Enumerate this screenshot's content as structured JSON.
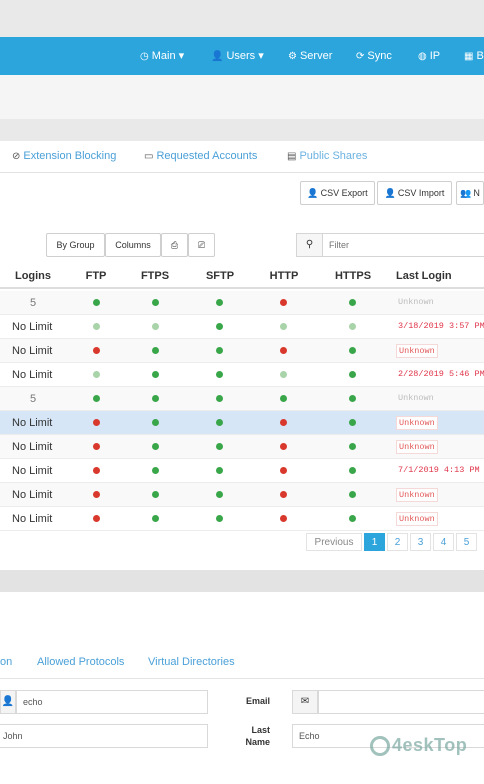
{
  "nav": {
    "items": [
      {
        "label": "Main",
        "icon": "clock-icon",
        "caret": "▾"
      },
      {
        "label": "Users",
        "icon": "user-icon",
        "caret": "▾"
      },
      {
        "label": "Server",
        "icon": "gear-icon",
        "caret": ""
      },
      {
        "label": "Sync",
        "icon": "sync-icon",
        "caret": ""
      },
      {
        "label": "IP",
        "icon": "globe-icon",
        "caret": ""
      },
      {
        "label": "B",
        "icon": "grid-icon",
        "caret": ""
      }
    ]
  },
  "tabs": [
    {
      "label": "Extension Blocking",
      "icon": "block-icon"
    },
    {
      "label": "Requested  Accounts",
      "icon": "inbox-icon"
    },
    {
      "label": "Public Shares",
      "icon": "share-icon"
    }
  ],
  "toolbar": {
    "csv_export": "CSV Export",
    "csv_import": "CSV Import",
    "new_label": "N",
    "by_group": "By Group",
    "columns": "Columns",
    "search_placeholder": "Filter"
  },
  "table": {
    "headers": [
      "Logins",
      "FTP",
      "FTPS",
      "SFTP",
      "HTTP",
      "HTTPS",
      "Last Login"
    ],
    "rows": [
      {
        "logins": "5",
        "faded": true,
        "ftp": "green",
        "ftps": "green",
        "sftp": "green",
        "http": "red",
        "https": "green",
        "last_login": "Unknown",
        "ll_style": "faded",
        "style": "alt"
      },
      {
        "logins": "No Limit",
        "faded": false,
        "ftp": "lightgreen",
        "ftps": "lightgreen",
        "sftp": "green",
        "http": "lightgreen",
        "https": "lightgreen",
        "last_login": "3/18/2019 3:57 PM",
        "ll_style": "date",
        "style": ""
      },
      {
        "logins": "No Limit",
        "faded": false,
        "ftp": "red",
        "ftps": "green",
        "sftp": "green",
        "http": "red",
        "https": "green",
        "last_login": "Unknown",
        "ll_style": "unknown",
        "style": "alt"
      },
      {
        "logins": "No Limit",
        "faded": false,
        "ftp": "lightgreen",
        "ftps": "green",
        "sftp": "green",
        "http": "lightgreen",
        "https": "green",
        "last_login": "2/28/2019 5:46 PM",
        "ll_style": "date",
        "style": ""
      },
      {
        "logins": "5",
        "faded": true,
        "ftp": "green",
        "ftps": "green",
        "sftp": "green",
        "http": "green",
        "https": "green",
        "last_login": "Unknown",
        "ll_style": "faded",
        "style": "alt"
      },
      {
        "logins": "No Limit",
        "faded": false,
        "ftp": "red",
        "ftps": "green",
        "sftp": "green",
        "http": "red",
        "https": "green",
        "last_login": "Unknown",
        "ll_style": "unknown",
        "style": "sel"
      },
      {
        "logins": "No Limit",
        "faded": false,
        "ftp": "red",
        "ftps": "green",
        "sftp": "green",
        "http": "red",
        "https": "green",
        "last_login": "Unknown",
        "ll_style": "unknown",
        "style": "alt"
      },
      {
        "logins": "No Limit",
        "faded": false,
        "ftp": "red",
        "ftps": "green",
        "sftp": "green",
        "http": "red",
        "https": "green",
        "last_login": "7/1/2019 4:13 PM",
        "ll_style": "date",
        "style": ""
      },
      {
        "logins": "No Limit",
        "faded": false,
        "ftp": "red",
        "ftps": "green",
        "sftp": "green",
        "http": "red",
        "https": "green",
        "last_login": "Unknown",
        "ll_style": "unknown",
        "style": "alt"
      },
      {
        "logins": "No Limit",
        "faded": false,
        "ftp": "red",
        "ftps": "green",
        "sftp": "green",
        "http": "red",
        "https": "green",
        "last_login": "Unknown",
        "ll_style": "unknown",
        "style": ""
      }
    ]
  },
  "pagination": {
    "previous": "Previous",
    "pages": [
      "1",
      "2",
      "3",
      "4",
      "5"
    ],
    "active": "1"
  },
  "form": {
    "tabs": [
      "on",
      "Allowed Protocols",
      "Virtual Directories"
    ],
    "username_value": "echo",
    "firstname_value": "John",
    "email_label": "Email",
    "lastname_label": "Last Name",
    "lastname_value": "Echo"
  },
  "watermark": "4eskTop",
  "colors": {
    "accent": "#2ba5dc",
    "green": "#3aa64a",
    "lightgreen": "#a9d3a8",
    "red": "#d9382c"
  }
}
